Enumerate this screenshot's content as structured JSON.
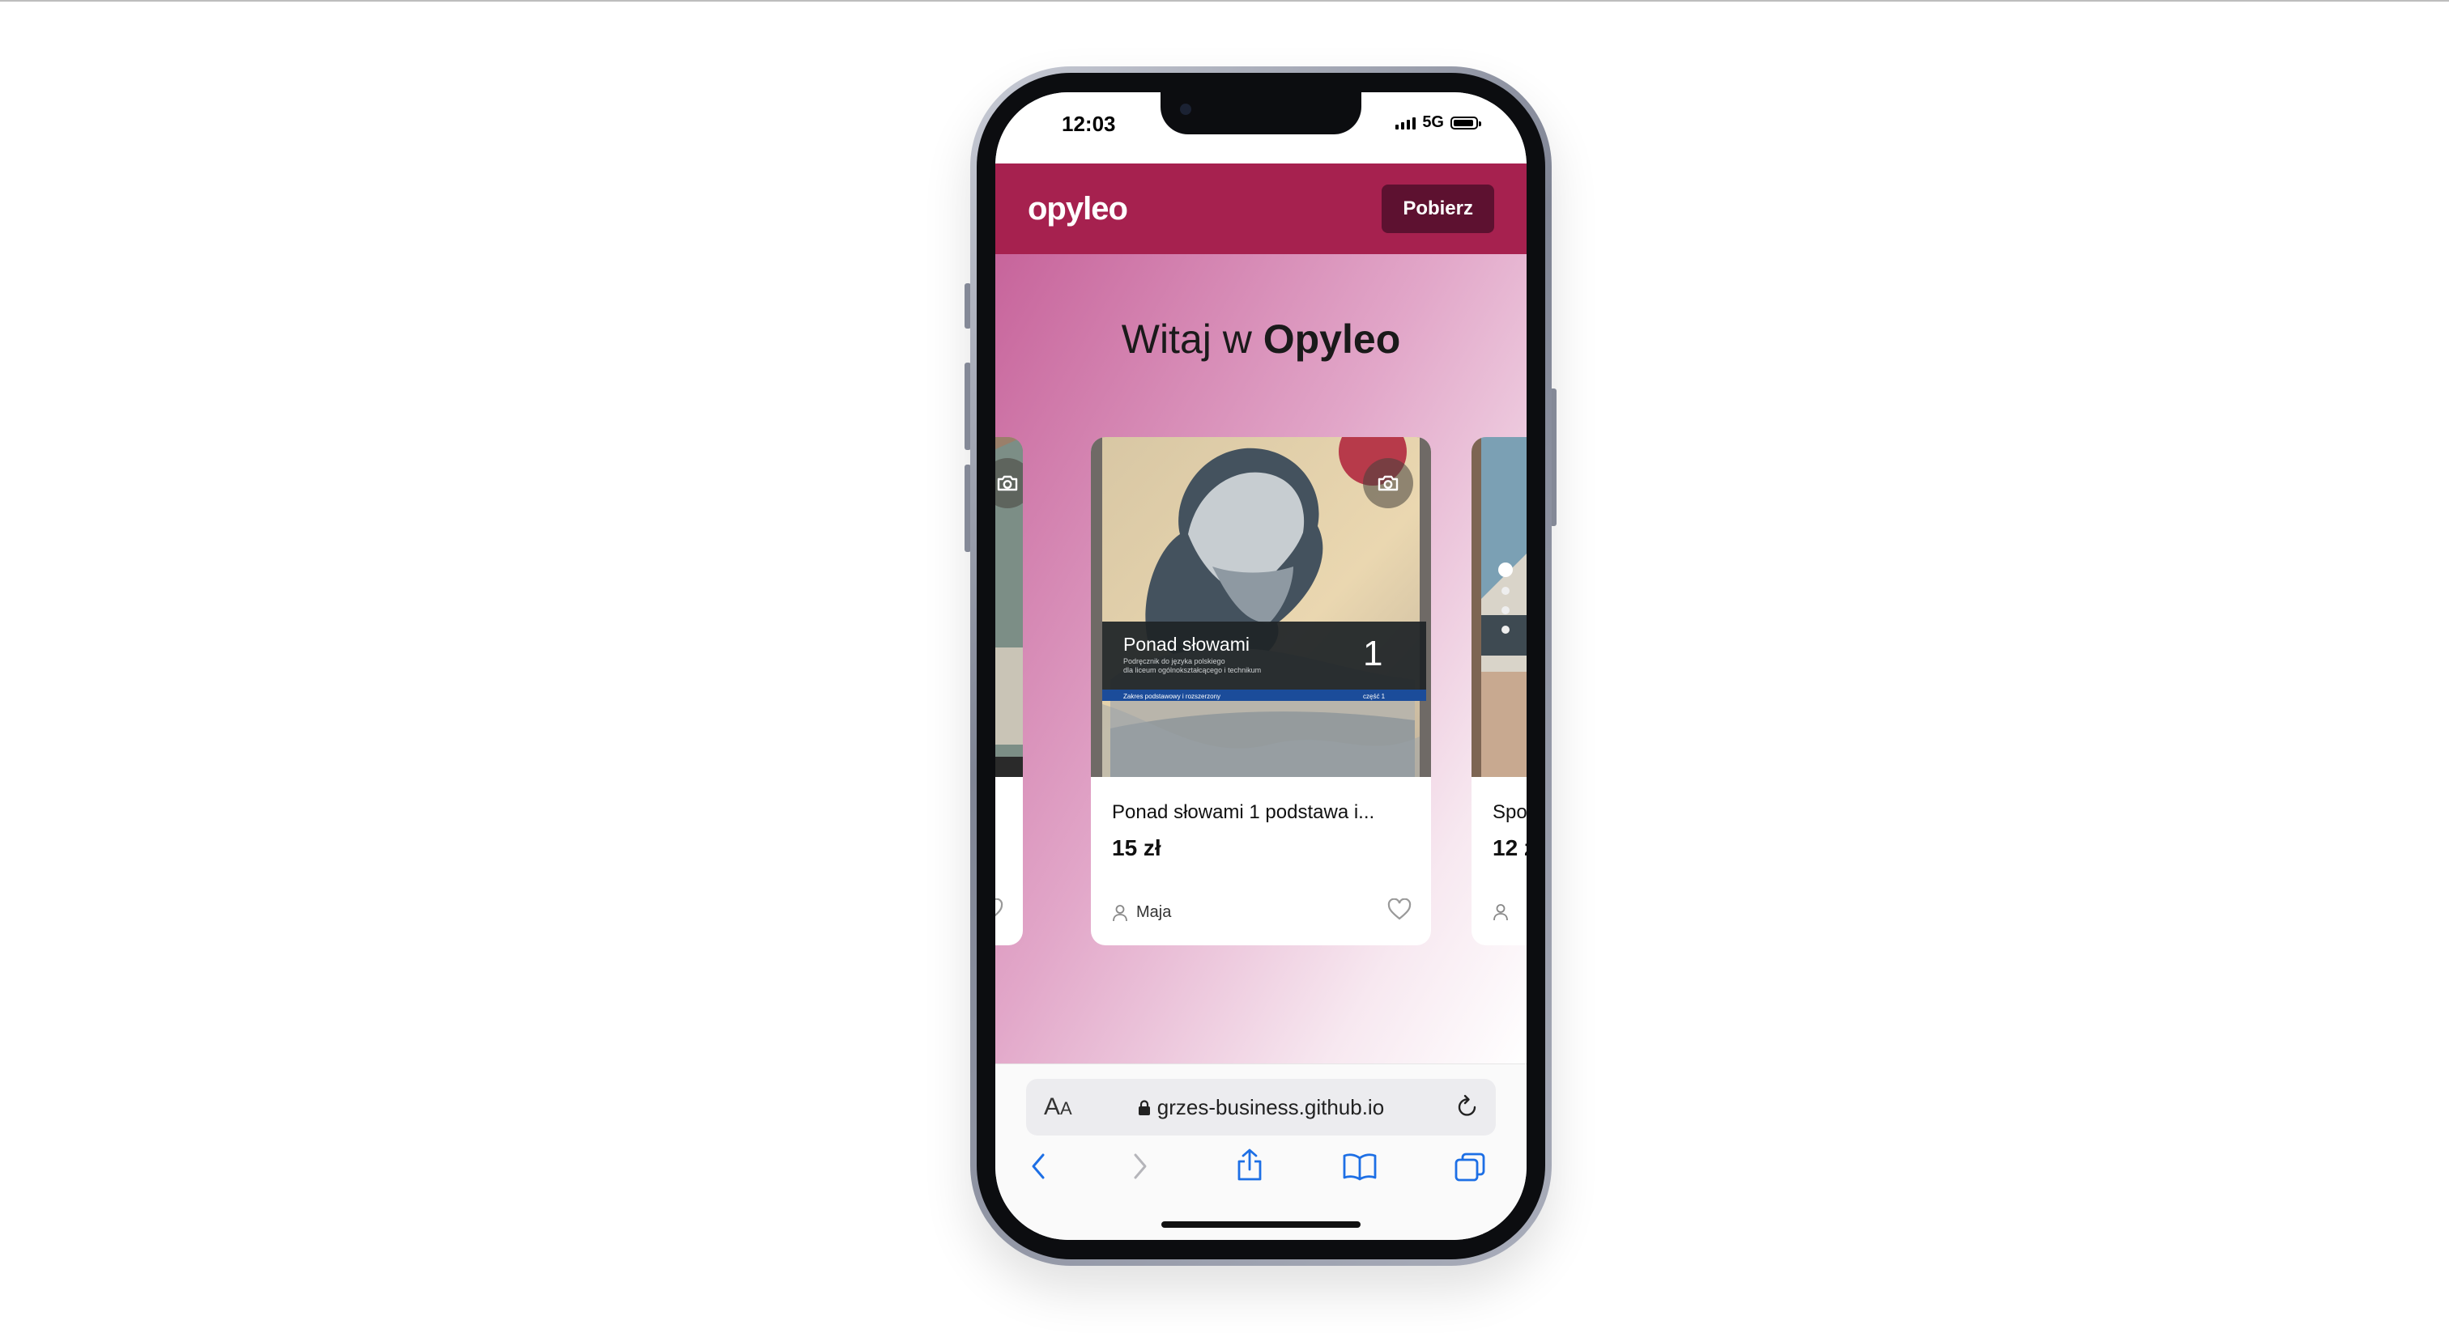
{
  "status": {
    "time": "12:03",
    "network": "5G"
  },
  "app": {
    "logo": "opyleo",
    "download_button": "Pobierz"
  },
  "hero": {
    "prefix": "Witaj w ",
    "brand": "Opyleo"
  },
  "cards": [
    {
      "title": "",
      "price": "",
      "user": ""
    },
    {
      "title": "Ponad słowami 1 podstawa i...",
      "price": "15 zł",
      "user": "Maja",
      "book_cover": {
        "title": "Ponad słowami",
        "number": "1",
        "subtitle_line1": "Podręcznik do języka polskiego",
        "subtitle_line2": "dla liceum ogólnokształcącego i technikum",
        "scope": "Zakres podstawowy i rozszerzony",
        "part": "część 1"
      }
    },
    {
      "title": "Spo",
      "price": "12 z",
      "user": ""
    }
  ],
  "browser": {
    "aa_label_large": "A",
    "aa_label_small": "A",
    "url": "grzes-business.github.io"
  },
  "colors": {
    "brand": "#a6214f",
    "button_dark": "#5d1130",
    "system_blue": "#1d6fe5"
  }
}
